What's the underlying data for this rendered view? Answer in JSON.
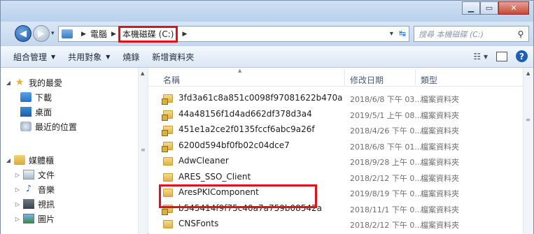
{
  "address": {
    "crumbs": [
      "電腦",
      "本機磁碟 (C:)"
    ]
  },
  "search": {
    "placeholder": "搜尋 本機磁碟 (C:)"
  },
  "toolbar": {
    "organize": "組合管理",
    "share": "共用對象",
    "burn": "燒錄",
    "new_folder": "新增資料夾"
  },
  "nav": {
    "favorites": "我的最愛",
    "downloads": "下載",
    "desktop": "桌面",
    "recent": "最近的位置",
    "libraries": "媒體櫃",
    "documents": "文件",
    "music": "音樂",
    "videos": "視訊",
    "pictures": "圖片"
  },
  "columns": {
    "name": "名稱",
    "date": "修改日期",
    "type": "類型"
  },
  "files": [
    {
      "name": "3fd3a61c8a851c0098f97081622b470a",
      "date": "2018/6/8 下午 03...",
      "type": "檔案資料夾",
      "locked": true
    },
    {
      "name": "44a48156f1d4ad662df378d3a4",
      "date": "2019/5/1 上午 08...",
      "type": "檔案資料夾",
      "locked": true
    },
    {
      "name": "451e1a2ce2f0135fccf6abc9a26f",
      "date": "2018/4/26 下午 0...",
      "type": "檔案資料夾",
      "locked": true
    },
    {
      "name": "6200d594bf0fb02c04dce7",
      "date": "2018/6/8 下午 01...",
      "type": "檔案資料夾",
      "locked": true
    },
    {
      "name": "AdwCleaner",
      "date": "2018/9/28 上午 0...",
      "type": "檔案資料夾",
      "locked": false
    },
    {
      "name": "ARES_SSO_Client",
      "date": "2018/2/12 下午 0...",
      "type": "檔案資料夾",
      "locked": false
    },
    {
      "name": "AresPKIComponent",
      "date": "2019/8/19 下午 0...",
      "type": "檔案資料夾",
      "locked": false
    },
    {
      "name": "b545414f9f75c40a7a759b08542a",
      "date": "2018/11/1 下午 0...",
      "type": "檔案資料夾",
      "locked": true
    },
    {
      "name": "CNSFonts",
      "date": "2018/2/12 下午 0...",
      "type": "檔案資料夾",
      "locked": false
    }
  ],
  "colors": {
    "highlight": "#e0101c",
    "accent": "#1d5fb3"
  }
}
